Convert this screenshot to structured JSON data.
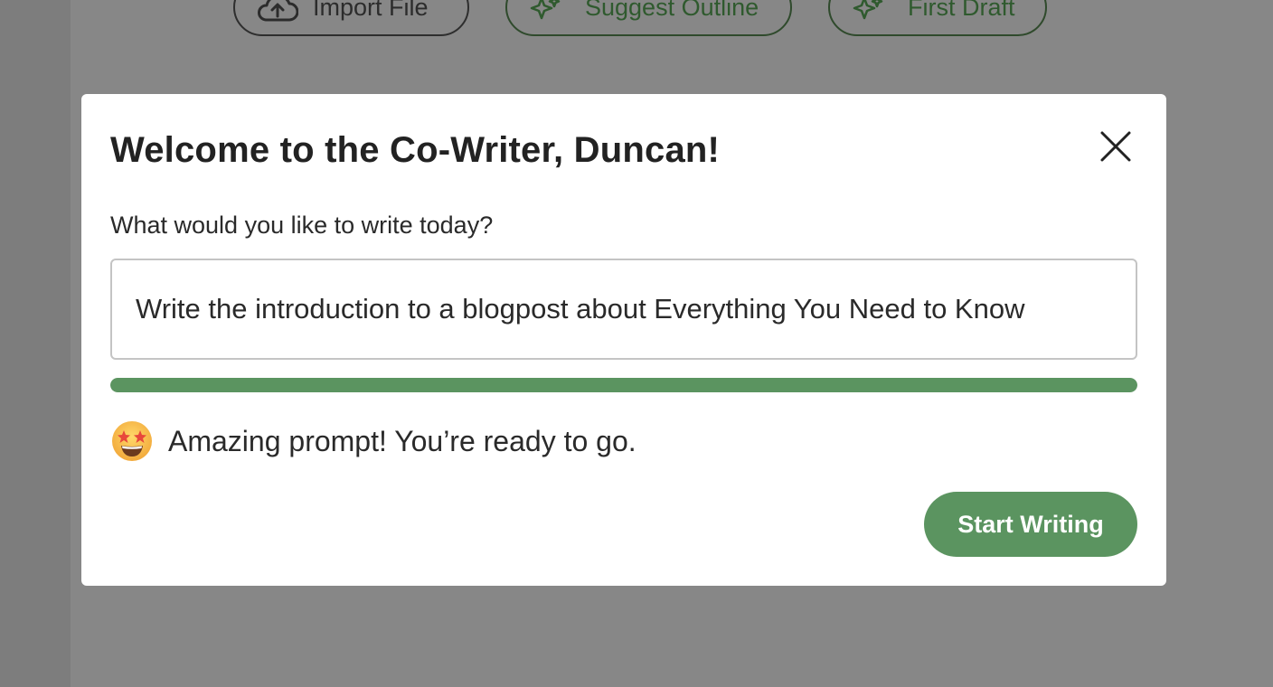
{
  "toolbar": {
    "import_label": "Import File",
    "outline_label": "Suggest Outline",
    "draft_label": "First Draft"
  },
  "modal": {
    "title": "Welcome to the Co-Writer, Duncan!",
    "prompt_label": "What would you like to write today?",
    "prompt_value": "Write the introduction to a blogpost about Everything You Need to Know",
    "prompt_strength_percent": 100,
    "feedback_text": "Amazing prompt! You’re ready to go.",
    "start_label": "Start Writing"
  },
  "colors": {
    "accent": "#5b9460",
    "accent_dark": "#2f5a2e",
    "overlay": "#808080"
  },
  "icons": {
    "close": "close-icon",
    "import": "cloud-upload-icon",
    "ai": "sparkle-icon",
    "feedback": "star-struck-emoji-icon"
  }
}
